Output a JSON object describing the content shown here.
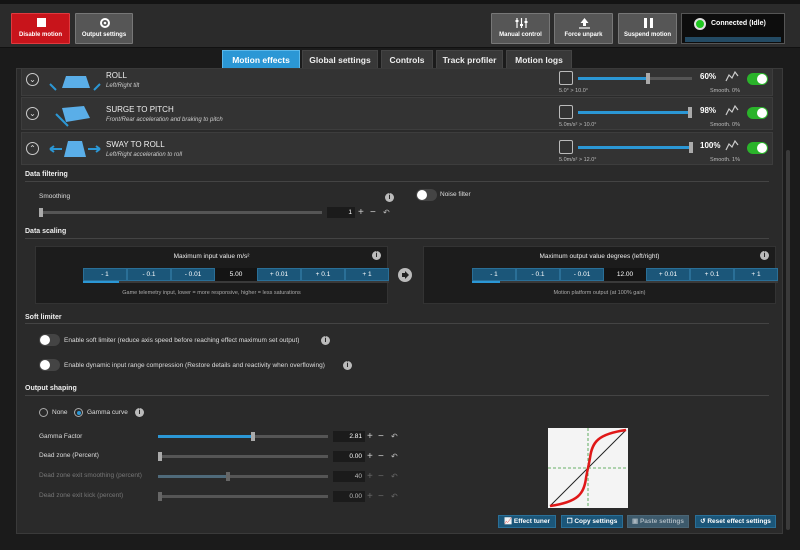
{
  "toolbar": {
    "disable_motion": "Disable motion",
    "output_settings": "Output settings",
    "manual_control": "Manual control",
    "force_unpark": "Force unpark",
    "suspend_motion": "Suspend motion"
  },
  "status": {
    "label": "Connected (Idle)",
    "color": "#1ec71e"
  },
  "tabs": [
    {
      "label": "Motion effects",
      "active": true
    },
    {
      "label": "Global settings"
    },
    {
      "label": "Controls"
    },
    {
      "label": "Track profiler"
    },
    {
      "label": "Motion logs"
    }
  ],
  "effects": [
    {
      "name": "ROLL",
      "desc": "Left/Right tilt",
      "percent": "60%",
      "level": 0.6,
      "range": "5.0° > 10.0°",
      "smooth": "Smooth. 0%",
      "enabled": true,
      "icon": "chevron-down-icon"
    },
    {
      "name": "SURGE TO PITCH",
      "desc": "Front/Rear acceleration and braking to pitch",
      "percent": "98%",
      "level": 0.98,
      "range": "5.0m/s² > 10.0°",
      "smooth": "Smooth. 0%",
      "enabled": true,
      "icon": "chevron-down-icon"
    },
    {
      "name": "SWAY TO ROLL",
      "desc": "Left/Right acceleration to roll",
      "percent": "100%",
      "level": 1.0,
      "range": "5.0m/s² > 12.0°",
      "smooth": "Smooth. 1%",
      "enabled": true,
      "icon": "chevron-up-icon"
    }
  ],
  "filtering": {
    "title": "Data filtering",
    "smoothing_label": "Smoothing",
    "smoothing_value": "1",
    "noise_filter_label": "Noise filter",
    "noise_filter_on": false
  },
  "scaling": {
    "title": "Data scaling",
    "input": {
      "title": "Maximum input value m/s²",
      "buttons": [
        "- 1",
        "- 0.1",
        "- 0.01",
        "+ 0.01",
        "+ 0.1",
        "+ 1"
      ],
      "value": "5.00",
      "footer": "Game telemetry input, lower = more responsive, higher = less saturations"
    },
    "output": {
      "title": "Maximum output value degrees (left/right)",
      "buttons": [
        "- 1",
        "- 0.1",
        "- 0.01",
        "+ 0.01",
        "+ 0.1",
        "+ 1"
      ],
      "value": "12.00",
      "footer": "Motion platform output (at 100% gain)"
    }
  },
  "soft_limiter": {
    "title": "Soft limiter",
    "option1": "Enable soft limiter (reduce axis speed before reaching effect maximum set output)",
    "option2": "Enable dynamic input range compression (Restore details and reactivity when overflowing)"
  },
  "shaping": {
    "title": "Output shaping",
    "radio_none": "None",
    "radio_gamma": "Gamma curve",
    "selected": "Gamma curve",
    "params": [
      {
        "label": "Gamma Factor",
        "value": "2.81",
        "level": 0.55,
        "enabled": true
      },
      {
        "label": "Dead zone (Percent)",
        "value": "0.00",
        "level": 0.0,
        "enabled": true
      },
      {
        "label": "Dead zone exit smoothing (percent)",
        "value": "40",
        "level": 0.4,
        "enabled": false
      },
      {
        "label": "Dead zone exit kick (percent)",
        "value": "0.00",
        "level": 0.0,
        "enabled": false
      }
    ]
  },
  "actions": {
    "effect_tuner": "Effect tuner",
    "copy_settings": "Copy settings",
    "paste_settings": "Paste settings",
    "reset_settings": "Reset effect settings"
  },
  "colors": {
    "accent": "#2b97d5",
    "danger": "#c8141b",
    "toggle_on": "#2ab32a",
    "curve": "#e01818"
  }
}
